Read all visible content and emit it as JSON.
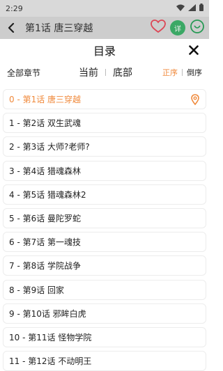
{
  "status": {
    "time": "2:29"
  },
  "app_bar": {
    "title": "第1话 唐三穿越",
    "badge_label": "详"
  },
  "sheet": {
    "title": "目录",
    "all_chapters": "全部章节",
    "current": "当前",
    "bottom": "底部",
    "asc": "正序",
    "desc": "倒序"
  },
  "colors": {
    "accent": "#f08a3c",
    "heart": "#e94a5a",
    "green": "#2aa35a"
  },
  "chapters": [
    {
      "label": "0 - 第1话 唐三穿越",
      "current": true
    },
    {
      "label": "1 - 第2话 双生武魂",
      "current": false
    },
    {
      "label": "2 - 第3话 大师?老师?",
      "current": false
    },
    {
      "label": "3 - 第4话 猎魂森林",
      "current": false
    },
    {
      "label": "4 - 第5话 猎魂森林2",
      "current": false
    },
    {
      "label": "5 - 第6话 曼陀罗蛇",
      "current": false
    },
    {
      "label": "6 - 第7话 第一魂技",
      "current": false
    },
    {
      "label": "7 - 第8话 学院战争",
      "current": false
    },
    {
      "label": "8 - 第9话 回家",
      "current": false
    },
    {
      "label": "9 - 第10话 邪眸白虎",
      "current": false
    },
    {
      "label": "10 - 第11话 怪物学院",
      "current": false
    },
    {
      "label": "11 - 第12话 不动明王",
      "current": false
    }
  ]
}
